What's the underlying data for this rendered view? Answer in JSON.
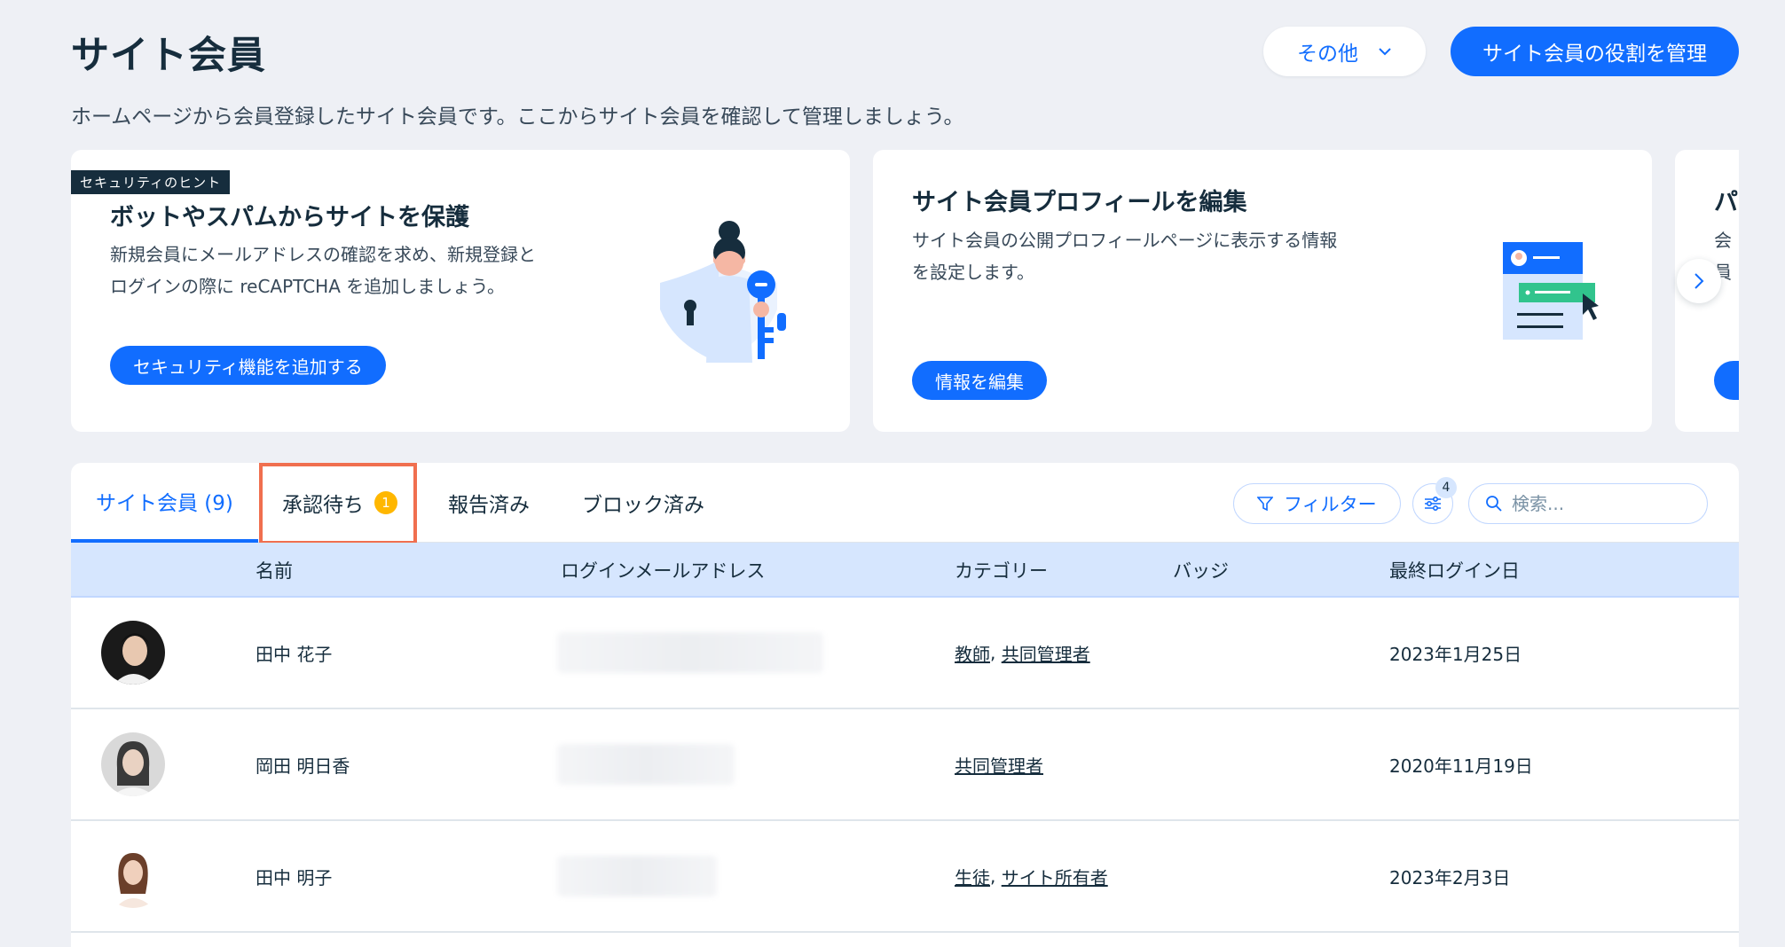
{
  "header": {
    "title": "サイト会員",
    "subtitle": "ホームページから会員登録したサイト会員です。ここからサイト会員を確認して管理しましょう。",
    "more_label": "その他",
    "manage_roles_label": "サイト会員の役割を管理"
  },
  "cards": [
    {
      "tag": "セキュリティのヒント",
      "title": "ボットやスパムからサイトを保護",
      "text_line1": "新規会員にメールアドレスの確認を求め、新規登録と",
      "text_line2": "ログインの際に reCAPTCHA を追加しましょう。",
      "button": "セキュリティ機能を追加する"
    },
    {
      "title": "サイト会員プロフィールを編集",
      "text_line1": "サイト会員の公開プロフィールページに表示する情報",
      "text_line2": "を設定します。",
      "button": "情報を編集"
    },
    {
      "title": "パ",
      "text_line1": "会",
      "text_line2": "員"
    }
  ],
  "tabs": [
    {
      "label": "サイト会員 (9)",
      "active": true
    },
    {
      "label": "承認待ち",
      "badge": "1"
    },
    {
      "label": "報告済み"
    },
    {
      "label": "ブロック済み"
    }
  ],
  "toolbar": {
    "filter_label": "フィルター",
    "settings_count": "4",
    "search_placeholder": "検索..."
  },
  "table": {
    "columns": [
      "名前",
      "ログインメールアドレス",
      "カテゴリー",
      "バッジ",
      "最終ログイン日"
    ],
    "rows": [
      {
        "name": "田中 花子",
        "categories": [
          "教師",
          "共同管理者"
        ],
        "last_login": "2023年1月25日"
      },
      {
        "name": "岡田 明日香",
        "categories": [
          "共同管理者"
        ],
        "last_login": "2020年11月19日"
      },
      {
        "name": "田中 明子",
        "categories": [
          "生徒",
          "サイト所有者"
        ],
        "last_login": "2023年2月3日"
      }
    ]
  },
  "colors": {
    "accent": "#116dff",
    "background": "#eef0f5",
    "badge": "#ffb700",
    "highlight": "#f06f4f",
    "table_header": "#d6e6fe"
  }
}
